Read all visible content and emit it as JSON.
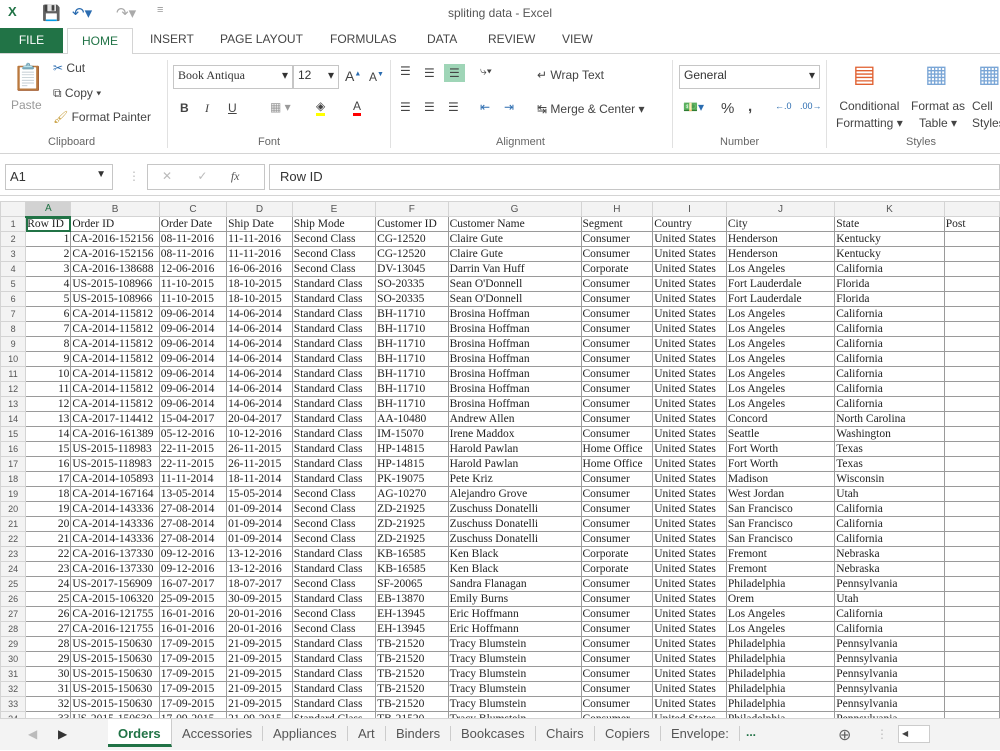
{
  "window": {
    "title": "spliting data - Excel",
    "app_icon": "excel-icon"
  },
  "quick_access": {
    "save": "save-icon",
    "undo": "undo-icon",
    "redo": "redo-icon"
  },
  "ribbon_tabs": [
    "FILE",
    "HOME",
    "INSERT",
    "PAGE LAYOUT",
    "FORMULAS",
    "DATA",
    "REVIEW",
    "VIEW"
  ],
  "ribbon": {
    "clipboard": {
      "paste": "Paste",
      "cut": "Cut",
      "copy": "Copy",
      "format_painter": "Format Painter",
      "label": "Clipboard"
    },
    "font": {
      "name": "Book Antiqua",
      "size": "12",
      "label": "Font",
      "bold": "B",
      "italic": "I",
      "underline": "U",
      "fill_color": "#ffff00",
      "font_color": "#ff0000"
    },
    "alignment": {
      "wrap": "Wrap Text",
      "merge": "Merge & Center",
      "label": "Alignment"
    },
    "number": {
      "format": "General",
      "percent": "%",
      "comma": ",",
      "label": "Number"
    },
    "styles": {
      "conditional": "Conditional",
      "conditional2": "Formatting",
      "format_table": "Format as",
      "format_table2": "Table",
      "cell": "Cell",
      "cell2": "Styles",
      "label": "Styles"
    }
  },
  "formula_bar": {
    "name_box": "A1",
    "fx": "fx",
    "value": "Row ID"
  },
  "columns": [
    "A",
    "B",
    "C",
    "D",
    "E",
    "F",
    "G",
    "H",
    "I",
    "J",
    "K",
    ""
  ],
  "headers": [
    "Row ID",
    "Order ID",
    "Order Date",
    "Ship Date",
    "Ship Mode",
    "Customer ID",
    "Customer Name",
    "Segment",
    "Country",
    "City",
    "State",
    "Post"
  ],
  "rows": [
    [
      "1",
      "CA-2016-152156",
      "08-11-2016",
      "11-11-2016",
      "Second Class",
      "CG-12520",
      "Claire Gute",
      "Consumer",
      "United States",
      "Henderson",
      "Kentucky"
    ],
    [
      "2",
      "CA-2016-152156",
      "08-11-2016",
      "11-11-2016",
      "Second Class",
      "CG-12520",
      "Claire Gute",
      "Consumer",
      "United States",
      "Henderson",
      "Kentucky"
    ],
    [
      "3",
      "CA-2016-138688",
      "12-06-2016",
      "16-06-2016",
      "Second Class",
      "DV-13045",
      "Darrin Van Huff",
      "Corporate",
      "United States",
      "Los Angeles",
      "California"
    ],
    [
      "4",
      "US-2015-108966",
      "11-10-2015",
      "18-10-2015",
      "Standard Class",
      "SO-20335",
      "Sean O'Donnell",
      "Consumer",
      "United States",
      "Fort Lauderdale",
      "Florida"
    ],
    [
      "5",
      "US-2015-108966",
      "11-10-2015",
      "18-10-2015",
      "Standard Class",
      "SO-20335",
      "Sean O'Donnell",
      "Consumer",
      "United States",
      "Fort Lauderdale",
      "Florida"
    ],
    [
      "6",
      "CA-2014-115812",
      "09-06-2014",
      "14-06-2014",
      "Standard Class",
      "BH-11710",
      "Brosina Hoffman",
      "Consumer",
      "United States",
      "Los Angeles",
      "California"
    ],
    [
      "7",
      "CA-2014-115812",
      "09-06-2014",
      "14-06-2014",
      "Standard Class",
      "BH-11710",
      "Brosina Hoffman",
      "Consumer",
      "United States",
      "Los Angeles",
      "California"
    ],
    [
      "8",
      "CA-2014-115812",
      "09-06-2014",
      "14-06-2014",
      "Standard Class",
      "BH-11710",
      "Brosina Hoffman",
      "Consumer",
      "United States",
      "Los Angeles",
      "California"
    ],
    [
      "9",
      "CA-2014-115812",
      "09-06-2014",
      "14-06-2014",
      "Standard Class",
      "BH-11710",
      "Brosina Hoffman",
      "Consumer",
      "United States",
      "Los Angeles",
      "California"
    ],
    [
      "10",
      "CA-2014-115812",
      "09-06-2014",
      "14-06-2014",
      "Standard Class",
      "BH-11710",
      "Brosina Hoffman",
      "Consumer",
      "United States",
      "Los Angeles",
      "California"
    ],
    [
      "11",
      "CA-2014-115812",
      "09-06-2014",
      "14-06-2014",
      "Standard Class",
      "BH-11710",
      "Brosina Hoffman",
      "Consumer",
      "United States",
      "Los Angeles",
      "California"
    ],
    [
      "12",
      "CA-2014-115812",
      "09-06-2014",
      "14-06-2014",
      "Standard Class",
      "BH-11710",
      "Brosina Hoffman",
      "Consumer",
      "United States",
      "Los Angeles",
      "California"
    ],
    [
      "13",
      "CA-2017-114412",
      "15-04-2017",
      "20-04-2017",
      "Standard Class",
      "AA-10480",
      "Andrew Allen",
      "Consumer",
      "United States",
      "Concord",
      "North Carolina"
    ],
    [
      "14",
      "CA-2016-161389",
      "05-12-2016",
      "10-12-2016",
      "Standard Class",
      "IM-15070",
      "Irene Maddox",
      "Consumer",
      "United States",
      "Seattle",
      "Washington"
    ],
    [
      "15",
      "US-2015-118983",
      "22-11-2015",
      "26-11-2015",
      "Standard Class",
      "HP-14815",
      "Harold Pawlan",
      "Home Office",
      "United States",
      "Fort Worth",
      "Texas"
    ],
    [
      "16",
      "US-2015-118983",
      "22-11-2015",
      "26-11-2015",
      "Standard Class",
      "HP-14815",
      "Harold Pawlan",
      "Home Office",
      "United States",
      "Fort Worth",
      "Texas"
    ],
    [
      "17",
      "CA-2014-105893",
      "11-11-2014",
      "18-11-2014",
      "Standard Class",
      "PK-19075",
      "Pete Kriz",
      "Consumer",
      "United States",
      "Madison",
      "Wisconsin"
    ],
    [
      "18",
      "CA-2014-167164",
      "13-05-2014",
      "15-05-2014",
      "Second Class",
      "AG-10270",
      "Alejandro Grove",
      "Consumer",
      "United States",
      "West Jordan",
      "Utah"
    ],
    [
      "19",
      "CA-2014-143336",
      "27-08-2014",
      "01-09-2014",
      "Second Class",
      "ZD-21925",
      "Zuschuss Donatelli",
      "Consumer",
      "United States",
      "San Francisco",
      "California"
    ],
    [
      "20",
      "CA-2014-143336",
      "27-08-2014",
      "01-09-2014",
      "Second Class",
      "ZD-21925",
      "Zuschuss Donatelli",
      "Consumer",
      "United States",
      "San Francisco",
      "California"
    ],
    [
      "21",
      "CA-2014-143336",
      "27-08-2014",
      "01-09-2014",
      "Second Class",
      "ZD-21925",
      "Zuschuss Donatelli",
      "Consumer",
      "United States",
      "San Francisco",
      "California"
    ],
    [
      "22",
      "CA-2016-137330",
      "09-12-2016",
      "13-12-2016",
      "Standard Class",
      "KB-16585",
      "Ken Black",
      "Corporate",
      "United States",
      "Fremont",
      "Nebraska"
    ],
    [
      "23",
      "CA-2016-137330",
      "09-12-2016",
      "13-12-2016",
      "Standard Class",
      "KB-16585",
      "Ken Black",
      "Corporate",
      "United States",
      "Fremont",
      "Nebraska"
    ],
    [
      "24",
      "US-2017-156909",
      "16-07-2017",
      "18-07-2017",
      "Second Class",
      "SF-20065",
      "Sandra Flanagan",
      "Consumer",
      "United States",
      "Philadelphia",
      "Pennsylvania"
    ],
    [
      "25",
      "CA-2015-106320",
      "25-09-2015",
      "30-09-2015",
      "Standard Class",
      "EB-13870",
      "Emily Burns",
      "Consumer",
      "United States",
      "Orem",
      "Utah"
    ],
    [
      "26",
      "CA-2016-121755",
      "16-01-2016",
      "20-01-2016",
      "Second Class",
      "EH-13945",
      "Eric Hoffmann",
      "Consumer",
      "United States",
      "Los Angeles",
      "California"
    ],
    [
      "27",
      "CA-2016-121755",
      "16-01-2016",
      "20-01-2016",
      "Second Class",
      "EH-13945",
      "Eric Hoffmann",
      "Consumer",
      "United States",
      "Los Angeles",
      "California"
    ],
    [
      "28",
      "US-2015-150630",
      "17-09-2015",
      "21-09-2015",
      "Standard Class",
      "TB-21520",
      "Tracy Blumstein",
      "Consumer",
      "United States",
      "Philadelphia",
      "Pennsylvania"
    ],
    [
      "29",
      "US-2015-150630",
      "17-09-2015",
      "21-09-2015",
      "Standard Class",
      "TB-21520",
      "Tracy Blumstein",
      "Consumer",
      "United States",
      "Philadelphia",
      "Pennsylvania"
    ],
    [
      "30",
      "US-2015-150630",
      "17-09-2015",
      "21-09-2015",
      "Standard Class",
      "TB-21520",
      "Tracy Blumstein",
      "Consumer",
      "United States",
      "Philadelphia",
      "Pennsylvania"
    ],
    [
      "31",
      "US-2015-150630",
      "17-09-2015",
      "21-09-2015",
      "Standard Class",
      "TB-21520",
      "Tracy Blumstein",
      "Consumer",
      "United States",
      "Philadelphia",
      "Pennsylvania"
    ],
    [
      "32",
      "US-2015-150630",
      "17-09-2015",
      "21-09-2015",
      "Standard Class",
      "TB-21520",
      "Tracy Blumstein",
      "Consumer",
      "United States",
      "Philadelphia",
      "Pennsylvania"
    ],
    [
      "33",
      "US-2015-150630",
      "17-09-2015",
      "21-09-2015",
      "Standard Class",
      "TB-21520",
      "Tracy Blumstein",
      "Consumer",
      "United States",
      "Philadelphia",
      "Pennsylvania"
    ]
  ],
  "sheets": [
    "Orders",
    "Accessories",
    "Appliances",
    "Art",
    "Binders",
    "Bookcases",
    "Chairs",
    "Copiers",
    "Envelope:"
  ],
  "active_sheet": "Orders",
  "sheet_more": "...",
  "colors": {
    "accent": "#217346"
  }
}
